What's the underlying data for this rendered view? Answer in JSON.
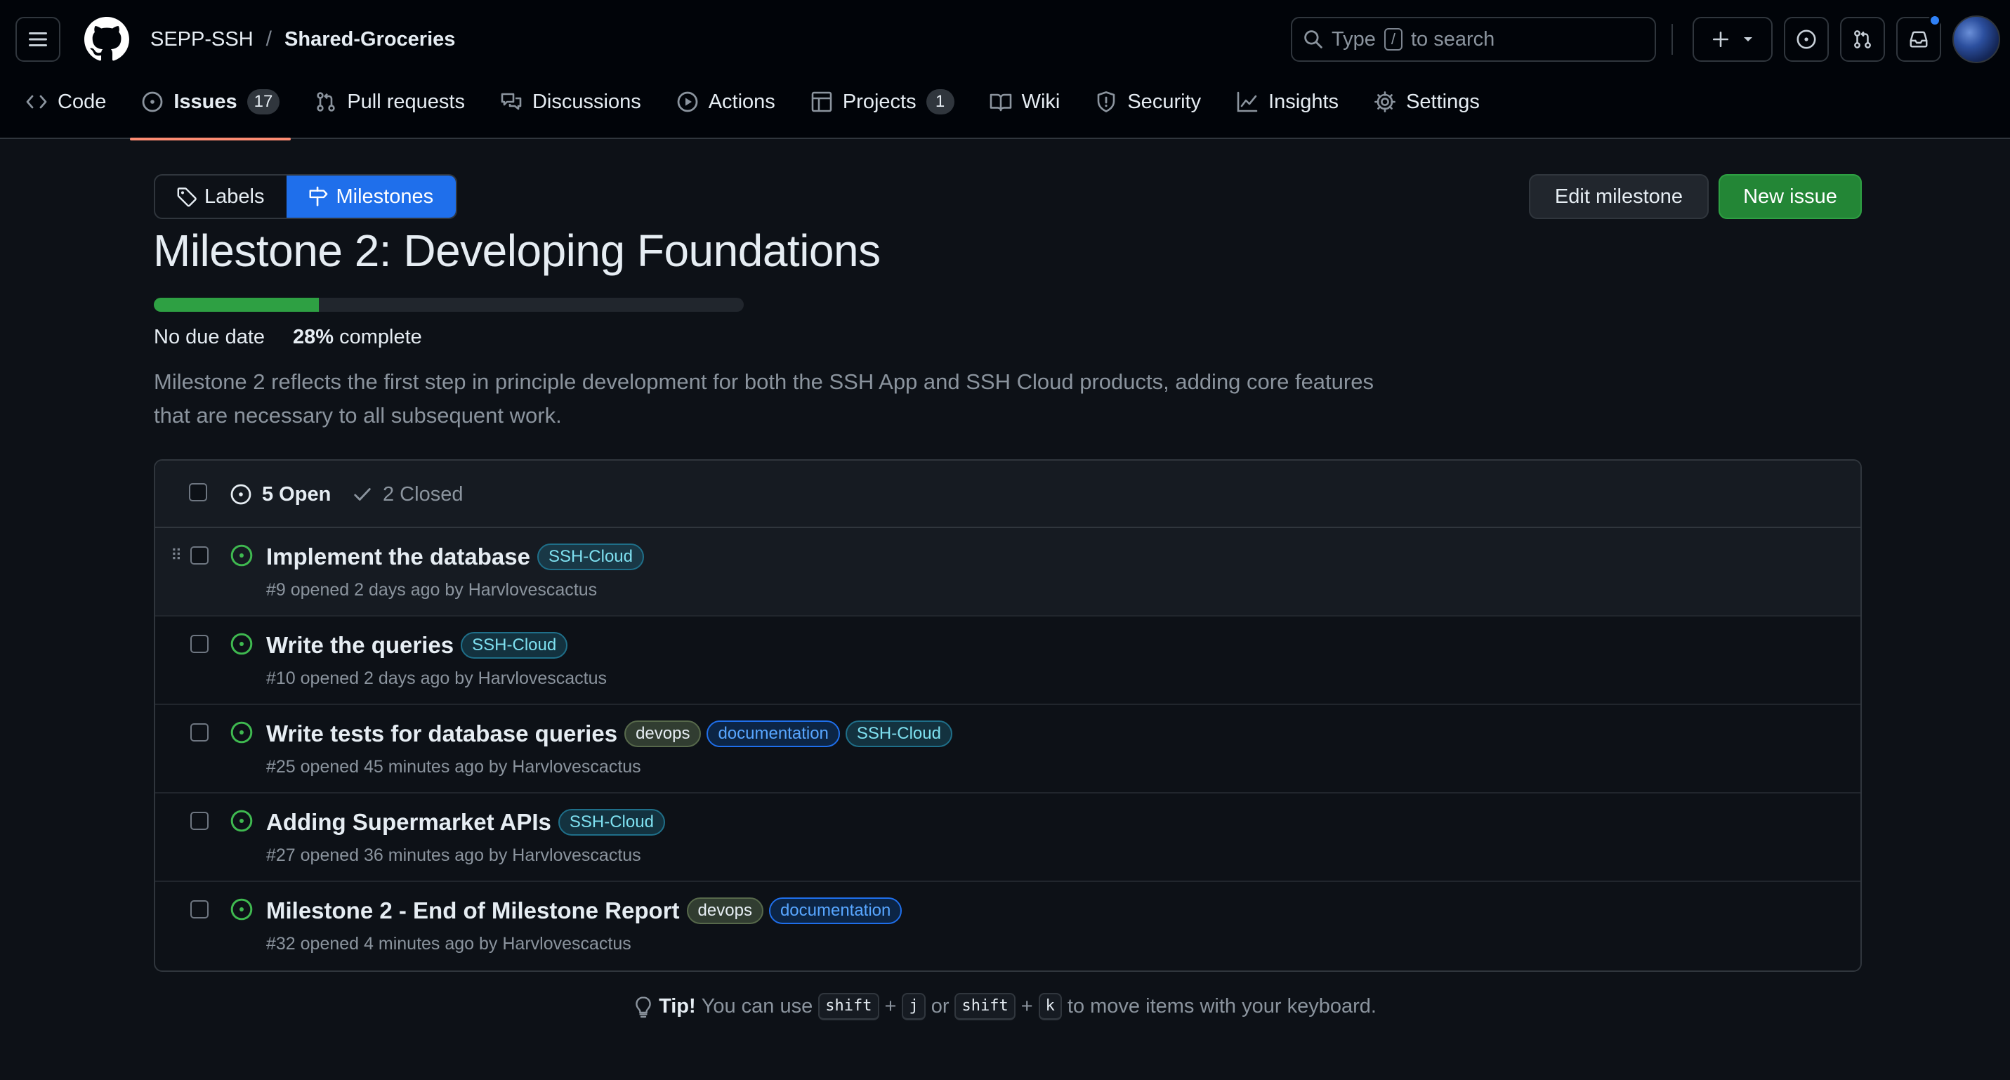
{
  "header": {
    "owner": "SEPP-SSH",
    "separator": "/",
    "repo": "Shared-Groceries",
    "search_prefix": "Type",
    "search_key": "/",
    "search_suffix": "to search"
  },
  "nav": {
    "tabs": [
      {
        "label": "Code",
        "icon": "code-icon"
      },
      {
        "label": "Issues",
        "icon": "issue-opened-icon",
        "count": "17",
        "active": true
      },
      {
        "label": "Pull requests",
        "icon": "git-pull-request-icon"
      },
      {
        "label": "Discussions",
        "icon": "comment-discussion-icon"
      },
      {
        "label": "Actions",
        "icon": "play-icon"
      },
      {
        "label": "Projects",
        "icon": "table-icon",
        "count": "1"
      },
      {
        "label": "Wiki",
        "icon": "book-icon"
      },
      {
        "label": "Security",
        "icon": "shield-icon"
      },
      {
        "label": "Insights",
        "icon": "graph-icon"
      },
      {
        "label": "Settings",
        "icon": "gear-icon"
      }
    ]
  },
  "subnav": {
    "labels": "Labels",
    "milestones": "Milestones"
  },
  "actions": {
    "edit_milestone": "Edit milestone",
    "new_issue": "New issue"
  },
  "milestone": {
    "title": "Milestone 2: Developing Foundations",
    "due": "No due date",
    "percent": "28%",
    "complete_label": "complete",
    "progress_fraction": 0.28,
    "description": "Milestone 2 reflects the first step in principle development for both the SSH App and SSH Cloud products, adding core features that are necessary to all subsequent work."
  },
  "issues_header": {
    "open": "5 Open",
    "closed": "2 Closed"
  },
  "issues": [
    {
      "title": "Implement the database",
      "labels": [
        {
          "text": "SSH-Cloud",
          "kind": "cloud"
        }
      ],
      "meta": "#9 opened 2 days ago by Harvlovescactus"
    },
    {
      "title": "Write the queries",
      "labels": [
        {
          "text": "SSH-Cloud",
          "kind": "cloud"
        }
      ],
      "meta": "#10 opened 2 days ago by Harvlovescactus"
    },
    {
      "title": "Write tests for database queries",
      "labels": [
        {
          "text": "devops",
          "kind": "devops"
        },
        {
          "text": "documentation",
          "kind": "doc"
        },
        {
          "text": "SSH-Cloud",
          "kind": "cloud"
        }
      ],
      "meta": "#25 opened 45 minutes ago by Harvlovescactus"
    },
    {
      "title": "Adding Supermarket APIs",
      "labels": [
        {
          "text": "SSH-Cloud",
          "kind": "cloud"
        }
      ],
      "meta": "#27 opened 36 minutes ago by Harvlovescactus"
    },
    {
      "title": "Milestone 2 - End of Milestone Report",
      "labels": [
        {
          "text": "devops",
          "kind": "devops"
        },
        {
          "text": "documentation",
          "kind": "doc"
        }
      ],
      "meta": "#32 opened 4 minutes ago by Harvlovescactus"
    }
  ],
  "tip": {
    "bold": "Tip!",
    "part1": "You can use",
    "key_shift": "shift",
    "plus": "+",
    "key_j": "j",
    "or": "or",
    "key_k": "k",
    "part2": "to move items with your keyboard."
  },
  "colors": {
    "accent_blue": "#1f6feb",
    "success_green": "#238636",
    "open_icon_green": "#3fb950",
    "active_tab_underline": "#fd8c73"
  }
}
